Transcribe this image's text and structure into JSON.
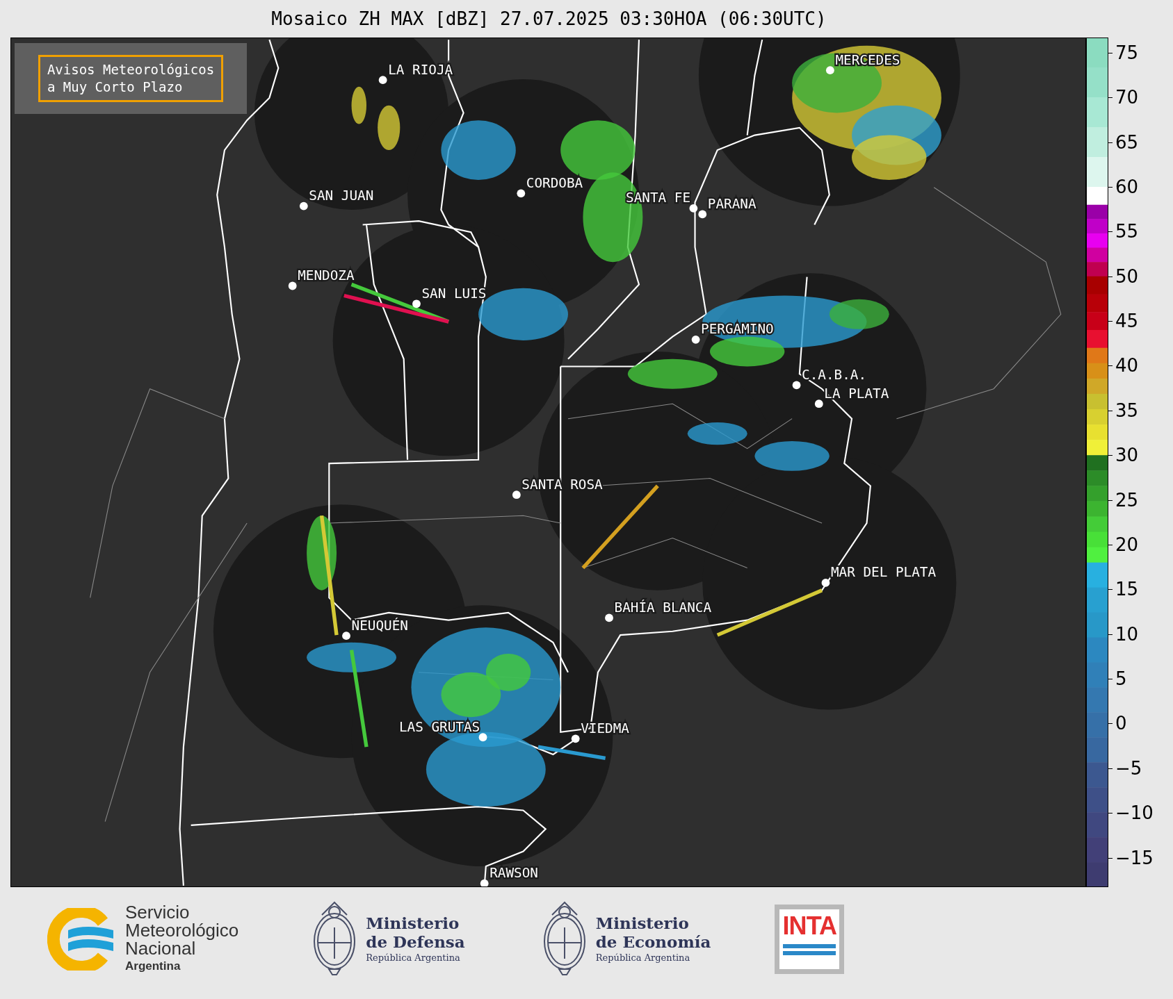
{
  "title": "Mosaico ZH MAX [dBZ] 27.07.2025 03:30HOA (06:30UTC)",
  "notice": {
    "lines": [
      "Avisos Meteorológicos",
      "a Muy Corto Plazo"
    ]
  },
  "cities": [
    {
      "name": "LA RIOJA"
    },
    {
      "name": "SAN JUAN"
    },
    {
      "name": "CORDOBA"
    },
    {
      "name": "SANTA FE"
    },
    {
      "name": "PARANA"
    },
    {
      "name": "MENDOZA"
    },
    {
      "name": "SAN LUIS"
    },
    {
      "name": "MERCEDES"
    },
    {
      "name": "PERGAMINO"
    },
    {
      "name": "C.A.B.A."
    },
    {
      "name": "LA PLATA"
    },
    {
      "name": "SANTA ROSA"
    },
    {
      "name": "MAR DEL PLATA"
    },
    {
      "name": "BAHÍA BLANCA"
    },
    {
      "name": "NEUQUÉN"
    },
    {
      "name": "LAS GRUTAS"
    },
    {
      "name": "VIEDMA"
    },
    {
      "name": "RAWSON"
    }
  ],
  "colorbar": {
    "ticks": [
      "75",
      "70",
      "65",
      "60",
      "55",
      "50",
      "45",
      "40",
      "35",
      "30",
      "25",
      "20",
      "15",
      "10",
      "5",
      "0",
      "−5",
      "−10",
      "−15"
    ]
  },
  "logos": [
    {
      "kind": "smn",
      "lines": [
        "Servicio",
        "Meteorológico",
        "Nacional"
      ],
      "subtitle": "Argentina"
    },
    {
      "kind": "ministry",
      "lines": [
        "Ministerio",
        "de Defensa"
      ],
      "subtitle": "República Argentina"
    },
    {
      "kind": "ministry",
      "lines": [
        "Ministerio",
        "de Economía"
      ],
      "subtitle": "República Argentina"
    },
    {
      "kind": "inta",
      "text": "INTA"
    }
  ]
}
